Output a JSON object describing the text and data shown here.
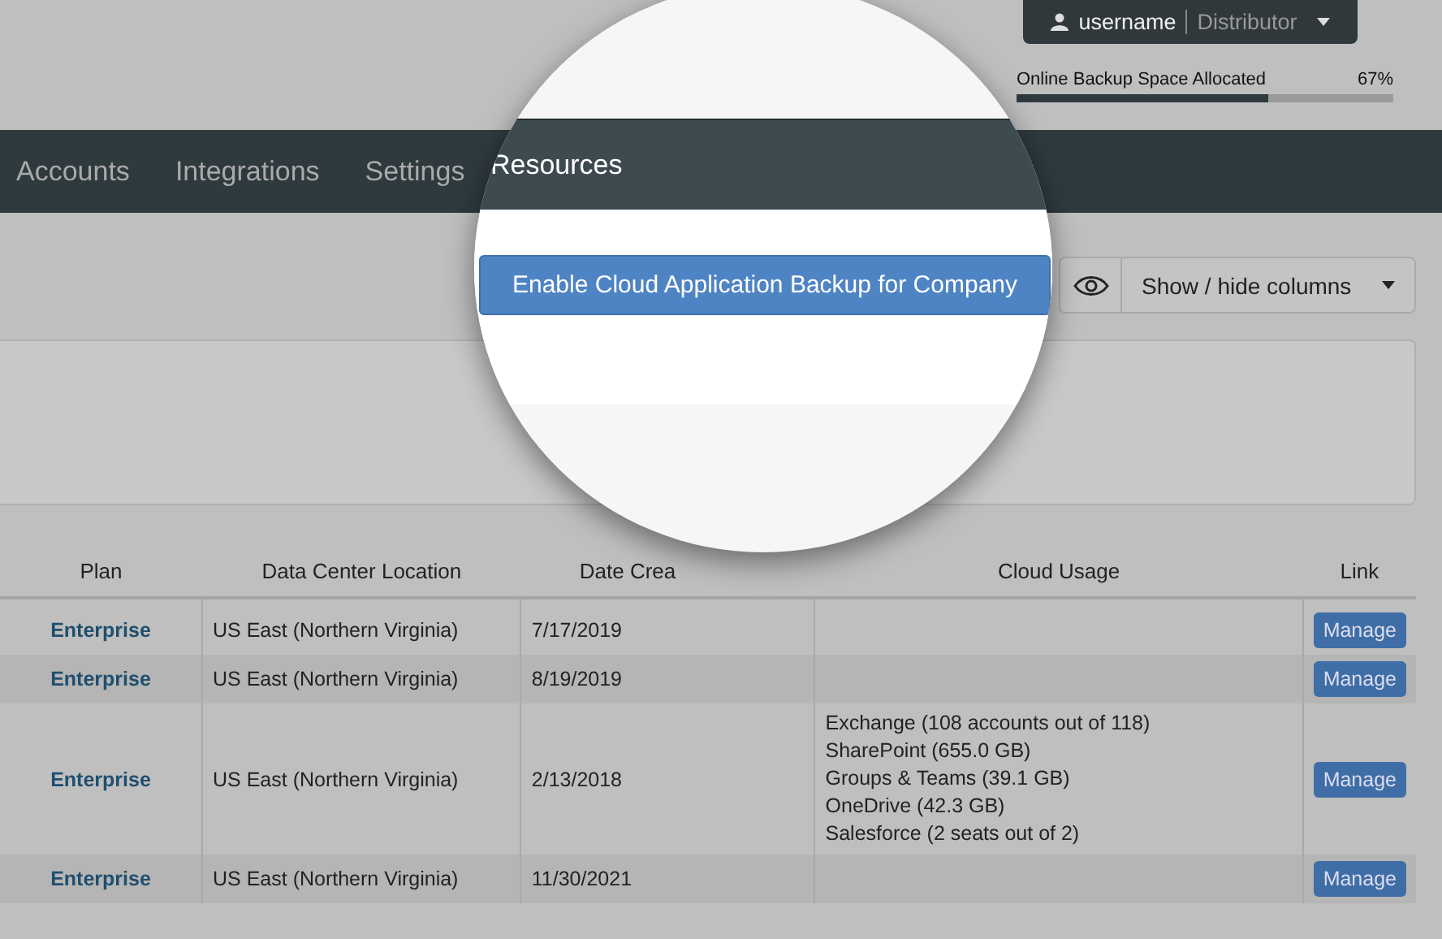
{
  "user_menu": {
    "username": "username",
    "role": "Distributor"
  },
  "storage": {
    "label": "Online Backup Space Allocated",
    "reading": "67%",
    "level": 0.67
  },
  "nav": {
    "items": [
      {
        "label": "Accounts",
        "selected": false
      },
      {
        "label": "Integrations",
        "selected": false
      },
      {
        "label": "Settings",
        "selected": false
      },
      {
        "label": "Resources",
        "selected": true
      }
    ]
  },
  "toolbar": {
    "primary_button": "Enable Cloud Application Backup for Company",
    "columns_button": "Show / hide columns"
  },
  "table": {
    "columns": [
      "Plan",
      "Data Center Location",
      "Date Crea",
      "Cloud Usage",
      "Link"
    ],
    "rows": [
      {
        "plan": "Enterprise",
        "location": "US East (Northern Virginia)",
        "date": "7/17/2019",
        "cloud_usage": [],
        "link": "Manage"
      },
      {
        "plan": "Enterprise",
        "location": "US East (Northern Virginia)",
        "date": "8/19/2019",
        "cloud_usage": [],
        "link": "Manage"
      },
      {
        "plan": "Enterprise",
        "location": "US East (Northern Virginia)",
        "date": "2/13/2018",
        "cloud_usage": [
          "Exchange (108 accounts out of 118)",
          "SharePoint (655.0 GB)",
          "Groups & Teams (39.1 GB)",
          "OneDrive (42.3 GB)",
          "Salesforce (2 seats out of 2)"
        ],
        "link": "Manage"
      },
      {
        "plan": "Enterprise",
        "location": "US East (Northern Virginia)",
        "date": "11/30/2021",
        "cloud_usage": [],
        "link": "Manage"
      }
    ]
  }
}
